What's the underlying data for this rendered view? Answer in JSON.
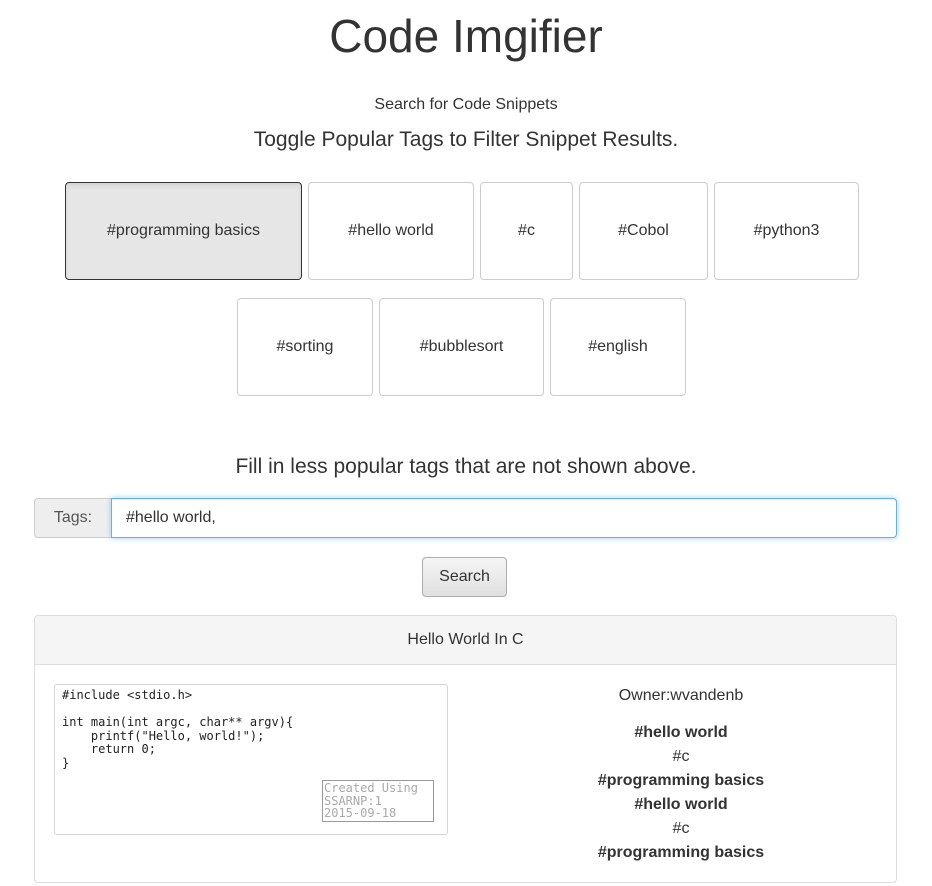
{
  "app": {
    "title": "Code Imgifier",
    "subtitle": "Search for Code Snippets",
    "toggle_heading": "Toggle Popular Tags to Filter Snippet Results."
  },
  "popular_tags": [
    {
      "label": "#programming basics",
      "active": true
    },
    {
      "label": "#hello world",
      "active": false
    },
    {
      "label": "#c",
      "active": false
    },
    {
      "label": "#Cobol",
      "active": false
    },
    {
      "label": "#python3",
      "active": false
    },
    {
      "label": "#sorting",
      "active": false
    },
    {
      "label": "#bubblesort",
      "active": false
    },
    {
      "label": "#english",
      "active": false
    }
  ],
  "less_popular": {
    "heading": "Fill in less popular tags that are not shown above.",
    "addon_label": "Tags:",
    "input_value": "#hello world,"
  },
  "search": {
    "button_label": "Search"
  },
  "result": {
    "title": "Hello World In C",
    "code": "#include <stdio.h>\n\nint main(int argc, char** argv){\n    printf(\"Hello, world!\");\n    return 0;\n}",
    "watermark": [
      "Created Using",
      "SSARNP:1",
      "2015-09-18"
    ],
    "owner": "Owner:wvandenb",
    "tags": [
      {
        "label": "#hello world",
        "bold": true
      },
      {
        "label": "#c",
        "bold": false
      },
      {
        "label": "#programming basics",
        "bold": true
      },
      {
        "label": "#hello world",
        "bold": true
      },
      {
        "label": "#c",
        "bold": false
      },
      {
        "label": "#programming basics",
        "bold": true
      }
    ]
  }
}
